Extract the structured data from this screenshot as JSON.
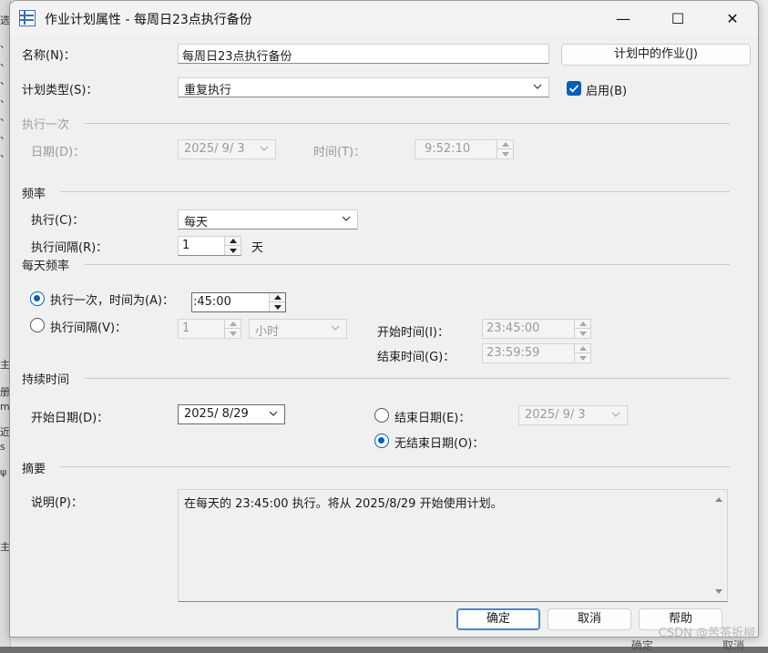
{
  "background": {
    "edge_chars": [
      "选",
      "、",
      "、",
      "、",
      "、",
      "、",
      "、",
      "、",
      "主",
      "册",
      "m",
      "近",
      "s",
      "ψ",
      "主"
    ],
    "buttons": [
      "确定",
      "取消"
    ]
  },
  "window": {
    "title": "作业计划属性 - 每周日23点执行备份",
    "controls": {
      "minimize": "—",
      "maximize": "☐",
      "close": "✕"
    }
  },
  "name_label": "名称(N)：",
  "name_value": "每周日23点执行备份",
  "jobs_in_schedule_button": "计划中的作业(J)",
  "schedule_type_label": "计划类型(S)：",
  "schedule_type_value": "重复执行",
  "enabled_label": "启用(B)",
  "enabled_checked": true,
  "one_time": {
    "section": "执行一次",
    "date_label": "日期(D)：",
    "date_value": "2025/ 9/ 3",
    "time_label": "时间(T)：",
    "time_value": "9:52:10"
  },
  "frequency": {
    "section": "频率",
    "occurs_label": "执行(C)：",
    "occurs_value": "每天",
    "interval_label": "执行间隔(R)：",
    "interval_value": "1",
    "interval_unit": "天"
  },
  "daily_frequency": {
    "section": "每天频率",
    "once_label": "执行一次，时间为(A)：",
    "once_time": ":45:00",
    "once_selected": true,
    "every_label": "执行间隔(V)：",
    "every_value": "1",
    "every_unit": "小时",
    "start_time_label": "开始时间(I)：",
    "start_time_value": "23:45:00",
    "end_time_label": "结束时间(G)：",
    "end_time_value": "23:59:59"
  },
  "duration": {
    "section": "持续时间",
    "start_date_label": "开始日期(D)：",
    "start_date_value": "2025/ 8/29",
    "end_date_label": "结束日期(E)：",
    "end_date_value": "2025/ 9/ 3",
    "no_end_date_label": "无结束日期(O)：",
    "no_end_selected": true
  },
  "summary": {
    "section": "摘要",
    "description_label": "说明(P)：",
    "description_text": "在每天的 23:45:00 执行。将从 2025/8/29 开始使用计划。"
  },
  "buttons": {
    "ok": "确定",
    "cancel": "取消",
    "help": "帮助"
  },
  "watermark": "CSDN @苦茶折柳",
  "colors": {
    "accent": "#005fb8",
    "dialog_bg": "#f0f0f0",
    "disabled_text": "#9a9a9a"
  }
}
